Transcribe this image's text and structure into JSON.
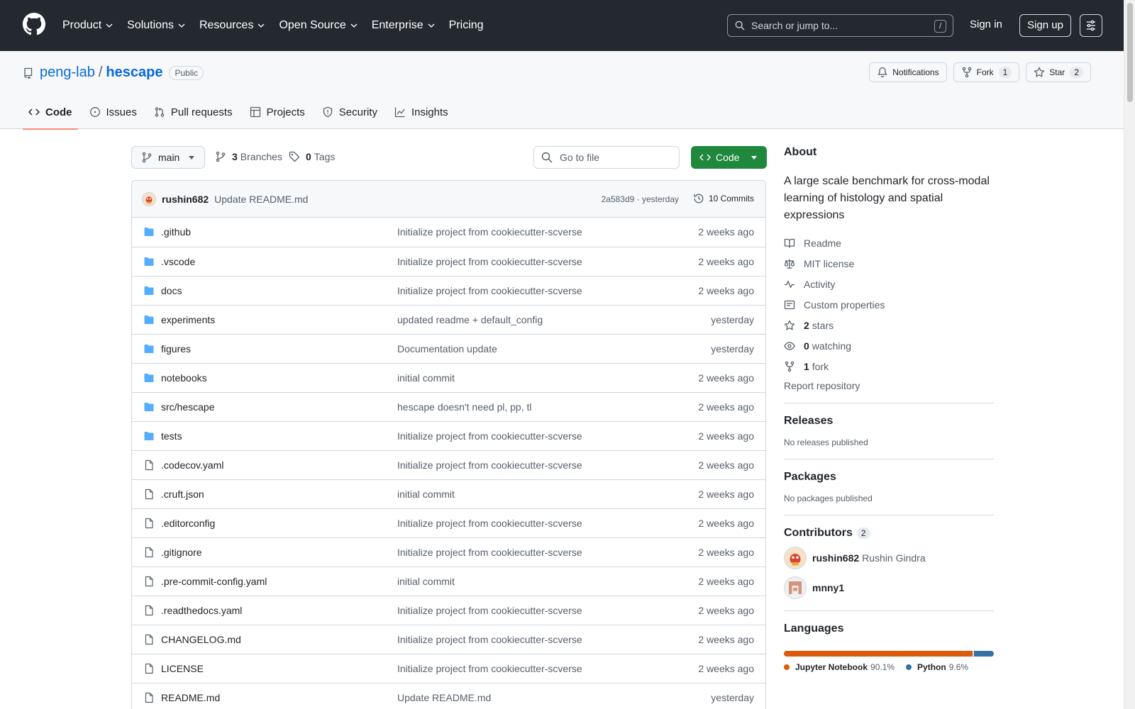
{
  "header": {
    "nav": [
      "Product",
      "Solutions",
      "Resources",
      "Open Source",
      "Enterprise",
      "Pricing"
    ],
    "search_placeholder": "Search or jump to...",
    "search_shortcut": "/",
    "sign_in": "Sign in",
    "sign_up": "Sign up"
  },
  "repo": {
    "owner": "peng-lab",
    "separator": "/",
    "name": "hescape",
    "visibility": "Public",
    "notifications_label": "Notifications",
    "fork_label": "Fork",
    "fork_count": "1",
    "star_label": "Star",
    "star_count": "2",
    "tabs": [
      {
        "label": "Code",
        "icon": "code-icon",
        "selected": true
      },
      {
        "label": "Issues",
        "icon": "issue-icon",
        "selected": false
      },
      {
        "label": "Pull requests",
        "icon": "pull-request-icon",
        "selected": false
      },
      {
        "label": "Projects",
        "icon": "table-icon",
        "selected": false
      },
      {
        "label": "Security",
        "icon": "shield-icon",
        "selected": false
      },
      {
        "label": "Insights",
        "icon": "graph-icon",
        "selected": false
      }
    ]
  },
  "file_nav": {
    "branch": "main",
    "branches_count": "3",
    "branches_label": "Branches",
    "tags_count": "0",
    "tags_label": "Tags",
    "goto_placeholder": "Go to file",
    "code_button": "Code"
  },
  "latest_commit": {
    "author": "rushin682",
    "message": "Update README.md",
    "meta": "2a583d9 · yesterday",
    "commits_label": "10 Commits"
  },
  "files": [
    {
      "type": "dir",
      "name": ".github",
      "message": "Initialize project from cookiecutter-scverse",
      "age": "2 weeks ago"
    },
    {
      "type": "dir",
      "name": ".vscode",
      "message": "Initialize project from cookiecutter-scverse",
      "age": "2 weeks ago"
    },
    {
      "type": "dir",
      "name": "docs",
      "message": "Initialize project from cookiecutter-scverse",
      "age": "2 weeks ago"
    },
    {
      "type": "dir",
      "name": "experiments",
      "message": "updated readme + default_config",
      "age": "yesterday"
    },
    {
      "type": "dir",
      "name": "figures",
      "message": "Documentation update",
      "age": "yesterday"
    },
    {
      "type": "dir",
      "name": "notebooks",
      "message": "initial commit",
      "age": "2 weeks ago"
    },
    {
      "type": "dir",
      "name": "src/hescape",
      "message": "hescape doesn't need pl, pp, tl",
      "age": "2 weeks ago"
    },
    {
      "type": "dir",
      "name": "tests",
      "message": "Initialize project from cookiecutter-scverse",
      "age": "2 weeks ago"
    },
    {
      "type": "file",
      "name": ".codecov.yaml",
      "message": "Initialize project from cookiecutter-scverse",
      "age": "2 weeks ago"
    },
    {
      "type": "file",
      "name": ".cruft.json",
      "message": "initial commit",
      "age": "2 weeks ago"
    },
    {
      "type": "file",
      "name": ".editorconfig",
      "message": "Initialize project from cookiecutter-scverse",
      "age": "2 weeks ago"
    },
    {
      "type": "file",
      "name": ".gitignore",
      "message": "Initialize project from cookiecutter-scverse",
      "age": "2 weeks ago"
    },
    {
      "type": "file",
      "name": ".pre-commit-config.yaml",
      "message": "initial commit",
      "age": "2 weeks ago"
    },
    {
      "type": "file",
      "name": ".readthedocs.yaml",
      "message": "Initialize project from cookiecutter-scverse",
      "age": "2 weeks ago"
    },
    {
      "type": "file",
      "name": "CHANGELOG.md",
      "message": "Initialize project from cookiecutter-scverse",
      "age": "2 weeks ago"
    },
    {
      "type": "file",
      "name": "LICENSE",
      "message": "Initialize project from cookiecutter-scverse",
      "age": "2 weeks ago"
    },
    {
      "type": "file",
      "name": "README.md",
      "message": "Update README.md",
      "age": "yesterday"
    }
  ],
  "about": {
    "title": "About",
    "description": "A large scale benchmark for cross-modal learning of histology and spatial expressions",
    "readme": "Readme",
    "license": "MIT license",
    "activity": "Activity",
    "custom_properties": "Custom properties",
    "stars_count": "2",
    "stars_label": "stars",
    "watching_count": "0",
    "watching_label": "watching",
    "forks_count": "1",
    "forks_label": "fork",
    "report": "Report repository"
  },
  "releases": {
    "title": "Releases",
    "empty": "No releases published"
  },
  "packages": {
    "title": "Packages",
    "empty": "No packages published"
  },
  "contributors": {
    "title": "Contributors",
    "count": "2",
    "list": [
      {
        "login": "rushin682",
        "name": "Rushin Gindra"
      },
      {
        "login": "mnny1",
        "name": ""
      }
    ]
  },
  "languages": {
    "title": "Languages",
    "list": [
      {
        "name": "Jupyter Notebook",
        "percent": "90.1%",
        "fraction": 0.901,
        "color": "#DA5B0B"
      },
      {
        "name": "Python",
        "percent": "9.6%",
        "fraction": 0.096,
        "color": "#3572A5"
      }
    ]
  },
  "colors": {
    "header_bg": "#24292f",
    "link": "#0969da",
    "primary_button": "#1f883d",
    "folder": "#54aeff",
    "tab_underline": "#fd8c73"
  }
}
